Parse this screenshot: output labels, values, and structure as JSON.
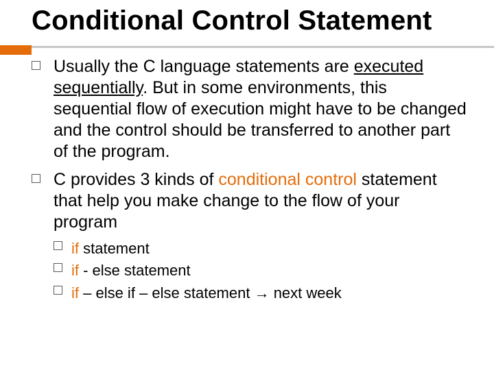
{
  "title": "Conditional Control Statement",
  "para1": {
    "t1": "Usually the C language statements are ",
    "t2": "executed sequentially",
    "t3": ". But in some environments, this sequential flow of execution might have to be changed and the control should be transferred  to another part of the program."
  },
  "para2": {
    "t1": "C provides 3 kinds of ",
    "t2": "conditional control",
    "t3": " statement  that help you make change to the flow of your program"
  },
  "sub": {
    "s1": {
      "kw": "if",
      "rest": " statement"
    },
    "s2": {
      "kw": "if",
      "rest": " - else statement"
    },
    "s3": {
      "kw": "if",
      "mid": " – else if – else  statement  ",
      "arrow": "→",
      "tail": " next week"
    }
  }
}
